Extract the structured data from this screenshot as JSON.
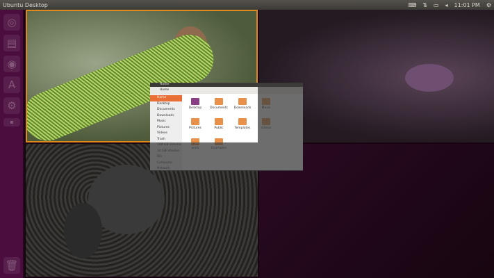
{
  "panel": {
    "title": "Ubuntu Desktop",
    "time": "11:01 PM"
  },
  "launcher": {
    "items": [
      "dash",
      "files",
      "browser",
      "software-center",
      "settings",
      "workspaces"
    ],
    "trash": "trash"
  },
  "window": {
    "title": "Home",
    "location": "Home",
    "sidebar": [
      "Home",
      "Desktop",
      "Documents",
      "Downloads",
      "Music",
      "Pictures",
      "Videos",
      "Trash",
      "168 GB Volume",
      "34 GB Volume",
      "Bin",
      "Computer",
      "Network"
    ],
    "folders": [
      "Desktop",
      "Documents",
      "Downloads",
      "Music",
      "Pictures",
      "Public",
      "Templates",
      "Videos",
      "work",
      "Examples"
    ]
  },
  "colors": {
    "accent": "#e08a1e",
    "launcher": "#4a0d3e"
  }
}
